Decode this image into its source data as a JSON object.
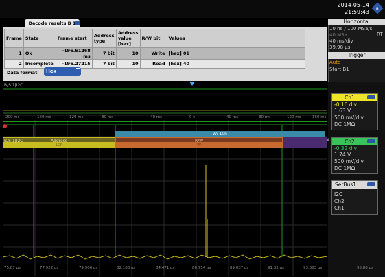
{
  "datetime": {
    "date": "2014-05-14",
    "time": "21:59:43"
  },
  "decode": {
    "tab_label": "Decode results B 1",
    "columns": [
      "Frame",
      "State",
      "Frame start",
      "Address type",
      "Address value [hex]",
      "R/W bit",
      "Values"
    ],
    "rows": [
      [
        "1",
        "Ok",
        "-196.51268 ms",
        "7 bit",
        "10",
        "Write",
        "[hex] 01"
      ],
      [
        "2",
        "Incomplete",
        "-196.27215",
        "7 bit",
        "10",
        "Read",
        "[hex] 40"
      ]
    ],
    "format_label": "Data format",
    "format_value": "Hex"
  },
  "horizontal": {
    "title": "Horizontal",
    "line1": "10 ns / 100 MSa/s",
    "line2": "40 MSa",
    "line3": "40 ms/div",
    "line4": "39.98 µs",
    "rt": "RT"
  },
  "trigger": {
    "title": "Trigger",
    "line1": "Auto",
    "line2": "Start B1"
  },
  "ch1": {
    "name": "Ch1",
    "offset": "-0.16 div",
    "level": "1.63 V",
    "scale": "500 mV/div",
    "coupling": "DC 1MΩ",
    "color": "#f0e428"
  },
  "ch2": {
    "name": "Ch2",
    "offset": "-0.32 div",
    "level": "1.74 V",
    "scale": "500 mV/div",
    "coupling": "DC 1MΩ",
    "color": "#39c45a"
  },
  "serbus": {
    "name": "SerBus1",
    "line1": "I2C",
    "line2": "Ch2",
    "line3": "Ch1"
  },
  "labels": {
    "top_row": "B/S 1|I2C",
    "bus_row": "B/S 1|I2C"
  },
  "upper_ticks": [
    "-200 ms",
    "-160 ms",
    "-120 ms",
    "-80 ms",
    "-40 ms",
    "0 s",
    "40 ms",
    "80 ms",
    "120 ms",
    "160 ms"
  ],
  "bottom_ticks": [
    "75.87 µs",
    "77.922 µs",
    "79.906 µs",
    "82.188 µs",
    "84.471 µs",
    "86.754 µs",
    "89.037 µs",
    "91.32 µs",
    "93.603 µs",
    "95.86 µs"
  ],
  "bus": {
    "w_label": "W: 10h",
    "address_label": "Address",
    "address_value": "10h",
    "rw_label": "R/W",
    "rw_value": "W",
    "ack_label": "A"
  }
}
